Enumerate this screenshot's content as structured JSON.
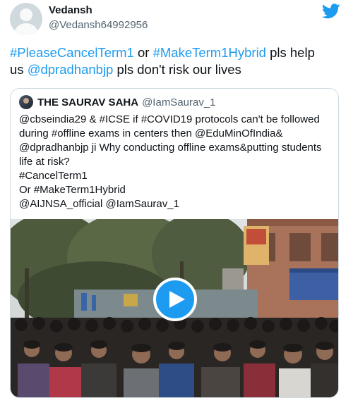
{
  "tweet": {
    "author_name": "Vedansh",
    "author_handle": "@Vedansh64992956",
    "line1_tag1": "#PleaseCancelTerm1",
    "line1_or": " or ",
    "line1_tag2": "#MakeTerm1Hybrid",
    "line1_end": " pls help",
    "line2_start": "us ",
    "line2_mention": "@dpradhanbjp",
    "line2_end": " pls don't risk our lives"
  },
  "quoted": {
    "author_name": "THE SAURAV SAHA",
    "author_handle": "@IamSaurav_1",
    "lines": [
      "@cbseindia29 & #ICSE if #COVID19 protocols can't be followed",
      "during #offline exams in  centers then @EduMinOfIndia&",
      "@dpradhanbjp ji Why conducting offline exams&putting students",
      "life at risk?",
      "#CancelTerm1",
      "Or #MakeTerm1Hybrid",
      "@AIJNSA_official @IamSaurav_1"
    ]
  },
  "colors": {
    "link": "#1d9bf0",
    "secondary": "#536471",
    "twitter_blue": "#1d9bf0"
  },
  "icons": {
    "brand": "twitter-bird-icon",
    "play": "play-icon"
  }
}
